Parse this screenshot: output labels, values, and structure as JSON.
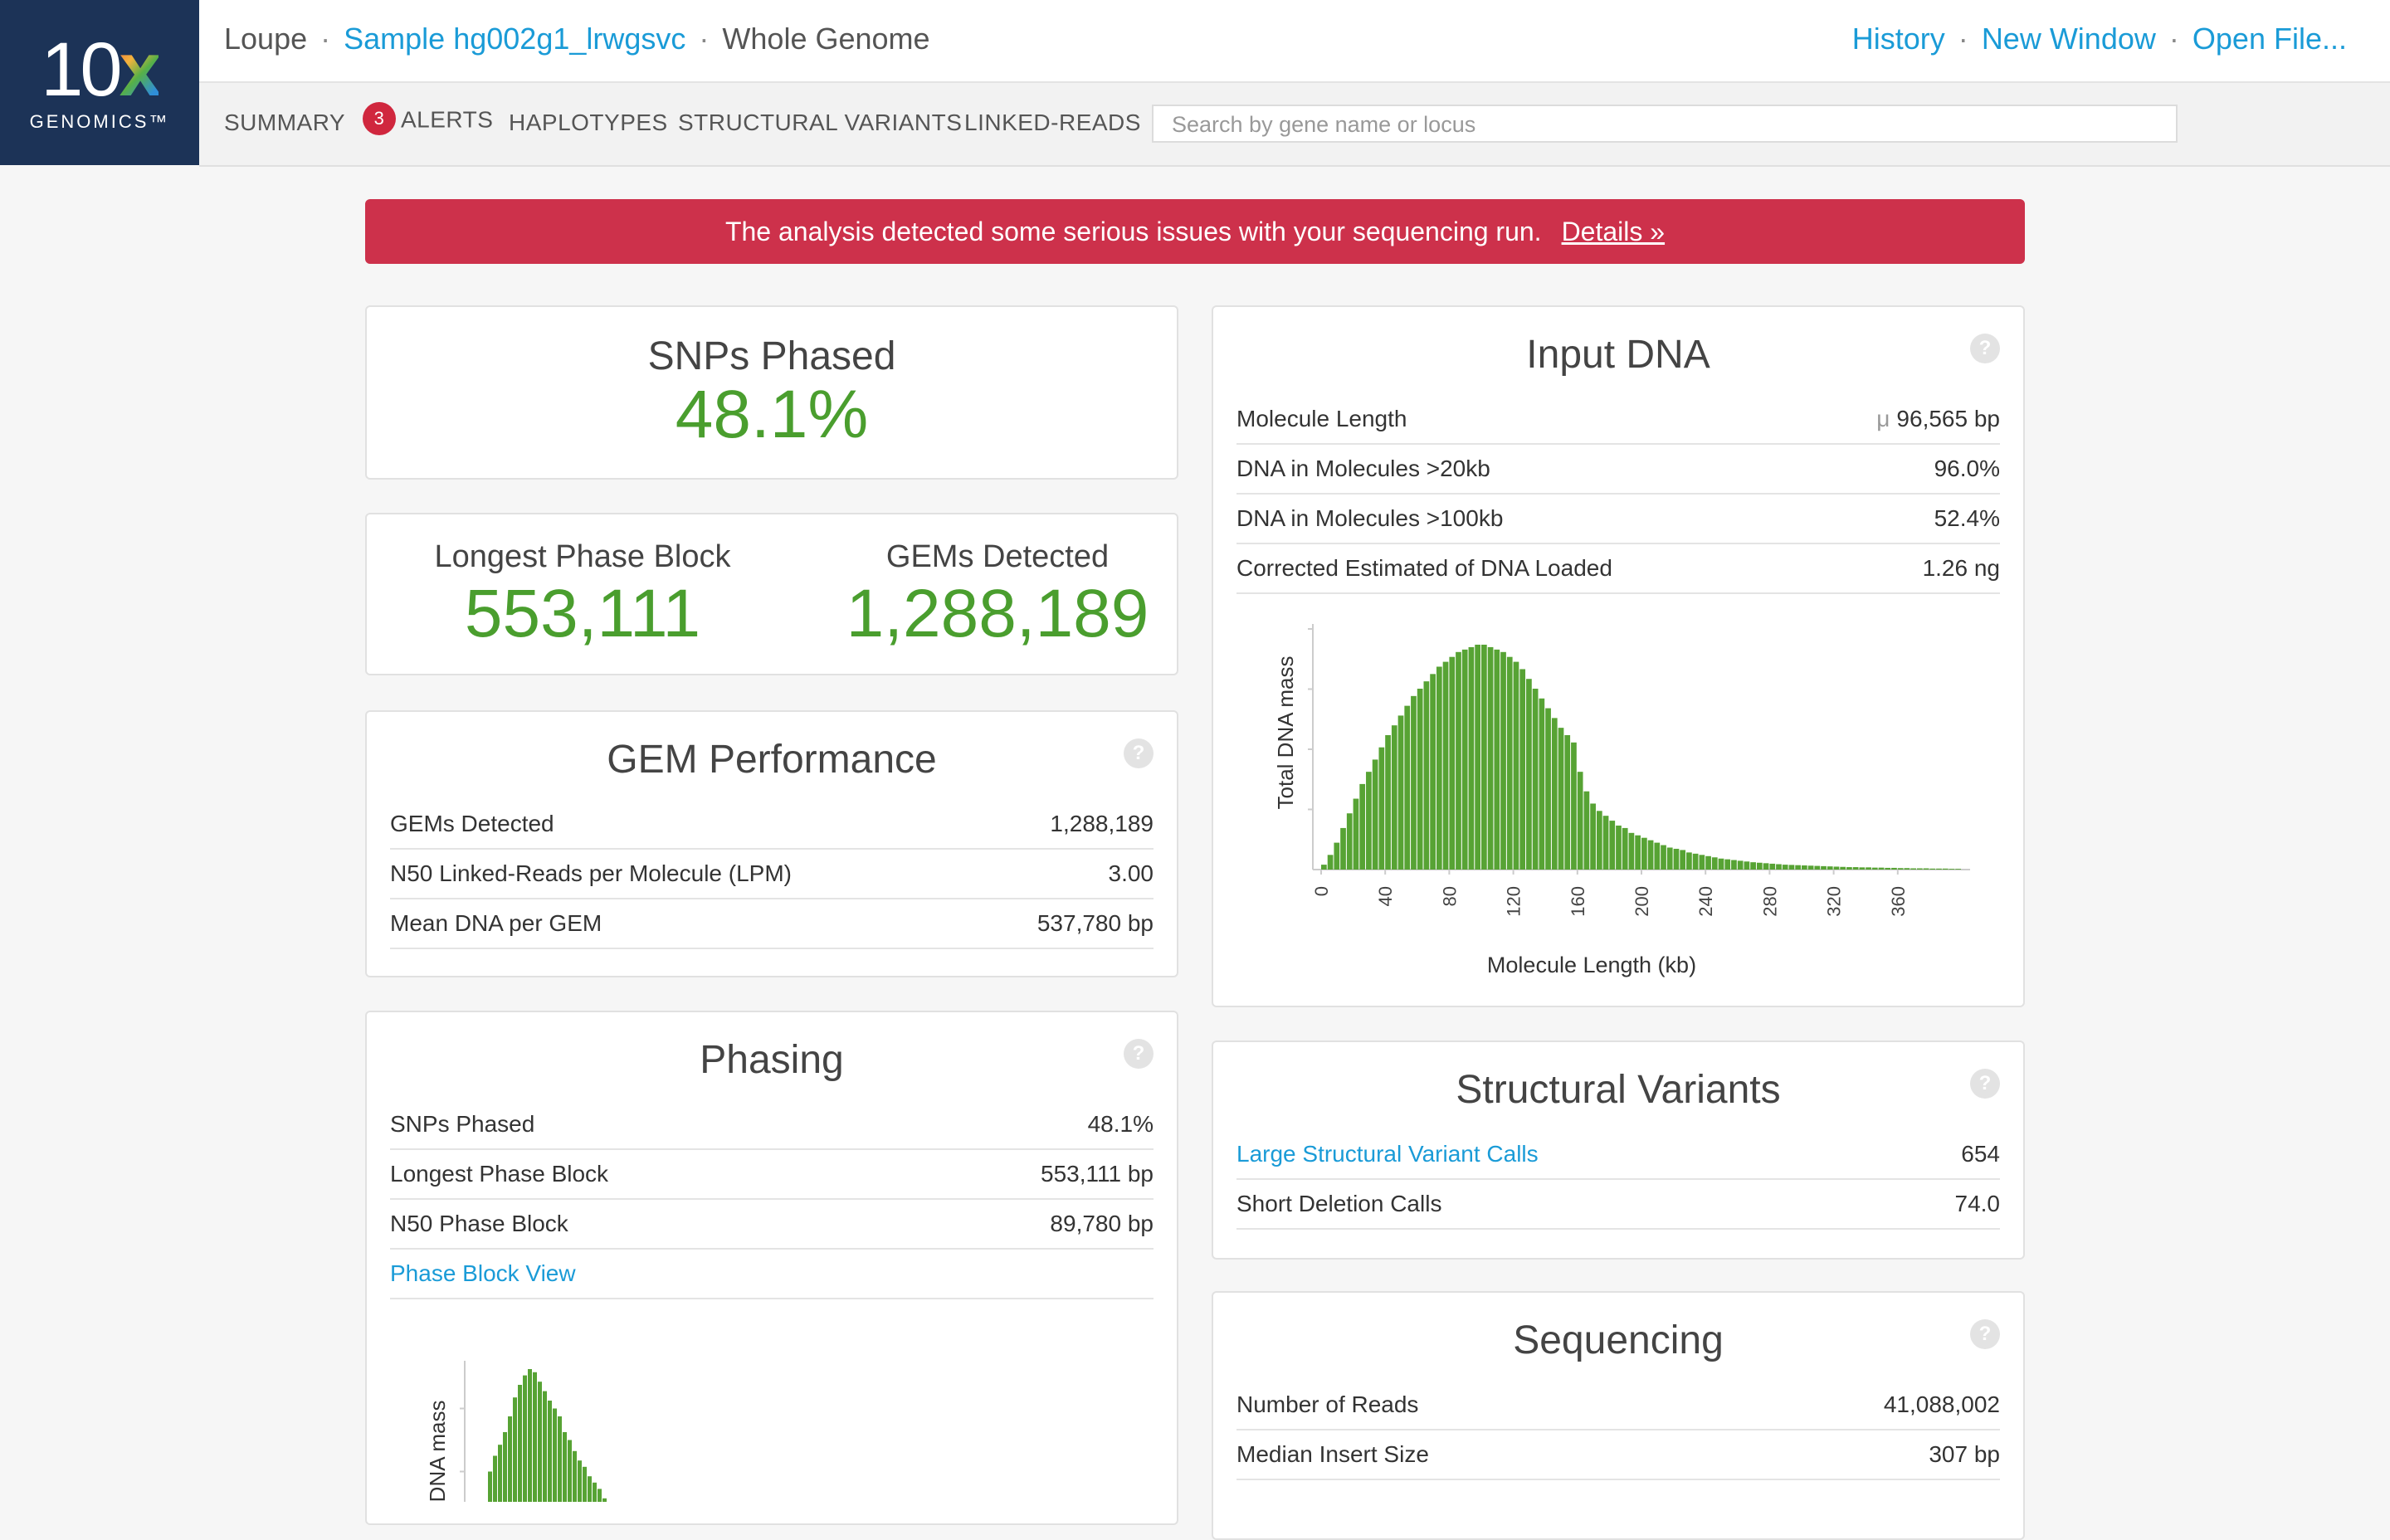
{
  "brand": {
    "logo_top": "10x",
    "logo_bottom": "GENOMICS™"
  },
  "header": {
    "app": "Loupe",
    "sample": "Sample hg002g1_lrwgsvc",
    "mode": "Whole Genome",
    "sep": "·",
    "links": [
      "History",
      "New Window",
      "Open File..."
    ]
  },
  "nav": {
    "summary": "SUMMARY",
    "alerts_count": "3",
    "alerts": "ALERTS",
    "haplotypes": "HAPLOTYPES",
    "structural_variants": "STRUCTURAL VARIANTS",
    "linked_reads": "LINKED-READS",
    "search_placeholder": "Search by gene name or locus"
  },
  "alert": {
    "message": "The analysis detected some serious issues with your sequencing run.",
    "link": "Details »"
  },
  "snps_phased_card": {
    "title": "SNPs Phased",
    "value": "48.1%"
  },
  "blocks_card": {
    "left_title": "Longest Phase Block",
    "left_value": "553,111",
    "right_title": "GEMs Detected",
    "right_value": "1,288,189"
  },
  "gem_performance": {
    "title": "GEM Performance",
    "help": "?",
    "rows": [
      {
        "label": "GEMs Detected",
        "value": "1,288,189"
      },
      {
        "label": "N50 Linked-Reads per Molecule (LPM)",
        "value": "3.00"
      },
      {
        "label": "Mean DNA per GEM",
        "value": "537,780 bp"
      }
    ]
  },
  "phasing": {
    "title": "Phasing",
    "help": "?",
    "rows": [
      {
        "label": "SNPs Phased",
        "value": "48.1%"
      },
      {
        "label": "Longest Phase Block",
        "value": "553,111 bp"
      },
      {
        "label": "N50 Phase Block",
        "value": "89,780 bp"
      }
    ],
    "link": "Phase Block View",
    "chart_ylabel": "Total DNA mass"
  },
  "input_dna": {
    "title": "Input DNA",
    "help": "?",
    "rows": [
      {
        "label": "Molecule Length",
        "prefix": "μ",
        "value": "96,565 bp"
      },
      {
        "label": "DNA in Molecules >20kb",
        "value": "96.0%"
      },
      {
        "label": "DNA in Molecules >100kb",
        "value": "52.4%"
      },
      {
        "label": "Corrected Estimated of DNA Loaded",
        "value": "1.26 ng"
      }
    ]
  },
  "structural_variants": {
    "title": "Structural Variants",
    "help": "?",
    "rows": [
      {
        "label": "Large Structural Variant Calls",
        "value": "654"
      },
      {
        "label": "Short Deletion Calls",
        "value": "74.0"
      }
    ]
  },
  "sequencing": {
    "title": "Sequencing",
    "help": "?",
    "rows": [
      {
        "label": "Number of Reads",
        "value": "41,088,002"
      },
      {
        "label": "Median Insert Size",
        "value": "307 bp"
      }
    ]
  },
  "colors": {
    "accent": "#1a9bd7",
    "green": "#4a9e2e",
    "alert": "#cd314b",
    "logo_bg": "#1c3357"
  },
  "chart_data": [
    {
      "type": "bar",
      "xlabel": "Molecule Length (kb)",
      "ylabel": "Total DNA mass",
      "xticks": [
        0,
        40,
        80,
        120,
        160,
        200,
        240,
        280,
        320,
        360
      ],
      "x": [
        0,
        4,
        8,
        12,
        16,
        20,
        24,
        28,
        32,
        36,
        40,
        44,
        48,
        52,
        56,
        60,
        64,
        68,
        72,
        76,
        80,
        84,
        88,
        92,
        96,
        100,
        104,
        108,
        112,
        116,
        120,
        124,
        128,
        132,
        136,
        140,
        144,
        148,
        152,
        156,
        160,
        164,
        168,
        172,
        176,
        180,
        184,
        188,
        192,
        196,
        200,
        204,
        208,
        212,
        216,
        220,
        224,
        228,
        232,
        236,
        240,
        244,
        248,
        252,
        256,
        260,
        264,
        268,
        272,
        276,
        280,
        284,
        288,
        292,
        296,
        300,
        304,
        308,
        312,
        316,
        320,
        324,
        328,
        332,
        336,
        340,
        344,
        348,
        352,
        356,
        360,
        364,
        368,
        372,
        376,
        380,
        384,
        388,
        392,
        396
      ],
      "values": [
        2,
        6,
        11,
        17,
        23,
        29,
        35,
        40,
        45,
        50,
        55,
        59,
        63,
        67,
        71,
        74,
        77,
        80,
        83,
        85,
        87,
        89,
        90,
        91,
        92,
        92,
        91,
        90,
        89,
        87,
        85,
        82,
        78,
        74,
        70,
        66,
        62,
        58,
        55,
        52,
        40,
        32,
        27,
        24,
        22,
        20,
        18,
        17,
        15,
        14,
        13,
        12,
        11,
        10,
        9,
        8.5,
        8,
        7,
        6.5,
        6,
        5.5,
        5,
        4.5,
        4.2,
        3.9,
        3.6,
        3.3,
        3,
        2.8,
        2.6,
        2.4,
        2.2,
        2,
        1.9,
        1.8,
        1.7,
        1.6,
        1.5,
        1.4,
        1.3,
        1.2,
        1.1,
        1,
        1,
        0.9,
        0.9,
        0.8,
        0.8,
        0.7,
        0.7,
        0.6,
        0.6,
        0.5,
        0.5,
        0.5,
        0.4,
        0.4,
        0.4,
        0.3,
        0.3
      ]
    },
    {
      "type": "bar",
      "ylabel": "Total DNA mass",
      "values": [
        35,
        45,
        52,
        60,
        70,
        82,
        90,
        96,
        100,
        98,
        92,
        86,
        80,
        75,
        70,
        60,
        55,
        48,
        42,
        38,
        32,
        28,
        24,
        18
      ]
    }
  ]
}
